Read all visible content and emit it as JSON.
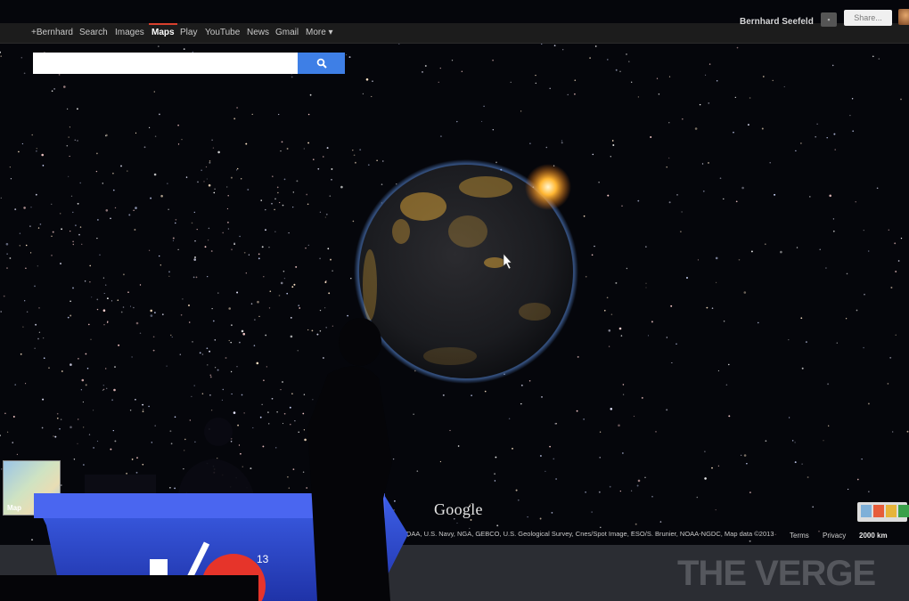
{
  "app": {
    "name": "Google Maps - Earth view"
  },
  "nav": {
    "items": [
      {
        "label": "+Bernhard",
        "active": false
      },
      {
        "label": "Search",
        "active": false
      },
      {
        "label": "Images",
        "active": false
      },
      {
        "label": "Maps",
        "active": true
      },
      {
        "label": "Play",
        "active": false
      },
      {
        "label": "YouTube",
        "active": false
      },
      {
        "label": "News",
        "active": false
      },
      {
        "label": "Gmail",
        "active": false
      },
      {
        "label": "More ▾",
        "active": false
      }
    ],
    "user_name": "Bernhard Seefeld",
    "share_label": "Share...",
    "notification_label": "▪"
  },
  "search": {
    "value": "",
    "placeholder": ""
  },
  "map": {
    "logo": "Google",
    "attribution": "DAA, U.S. Navy, NGA, GEBCO, U.S. Geological Survey, Cnes/Spot Image, ESO/S. Brunier, NOAA-NGDC, Map data ©2013",
    "terms_label": "Terms",
    "privacy_label": "Privacy",
    "scale_label": "2000 km",
    "minimap_label": "Map"
  },
  "stage": {
    "event_text": "I/O",
    "year_superscript": "13"
  },
  "watermark": "THE VERGE",
  "colors": {
    "accent_blue": "#3e7fe6",
    "active_tab_red": "#d9402d",
    "space": "#05060b",
    "stage_blue": "#2a4fd6"
  }
}
